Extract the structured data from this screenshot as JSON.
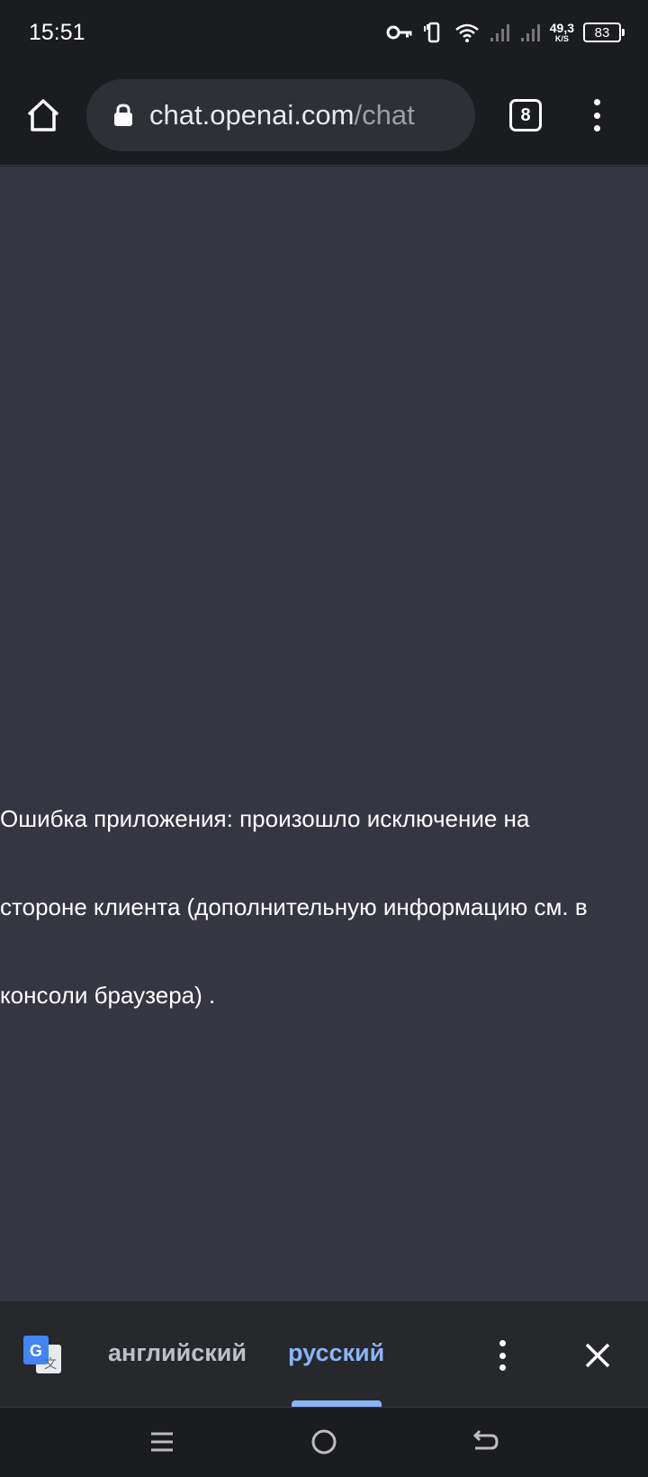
{
  "status_bar": {
    "time": "15:51",
    "speed_value": "49,3",
    "speed_unit": "K/S",
    "battery": "83"
  },
  "browser": {
    "url_host": "chat.openai.com",
    "url_path": "/chat",
    "tab_count": "8",
    "icons": [
      "home-icon",
      "lock-icon",
      "overflow-menu-icon"
    ]
  },
  "page": {
    "background_color": "#363642",
    "error_lines": [
      "Ошибка приложения: произошло исключение на",
      "стороне клиента (дополнительную информацию см. в",
      "консоли браузера) ."
    ]
  },
  "translate_bar": {
    "source_language": "английский",
    "target_language": "русский",
    "selected": "русский",
    "accent_color": "#8ab4f8"
  },
  "nav_bar": {
    "buttons": [
      "recents-icon",
      "home-circle-icon",
      "back-icon"
    ]
  }
}
